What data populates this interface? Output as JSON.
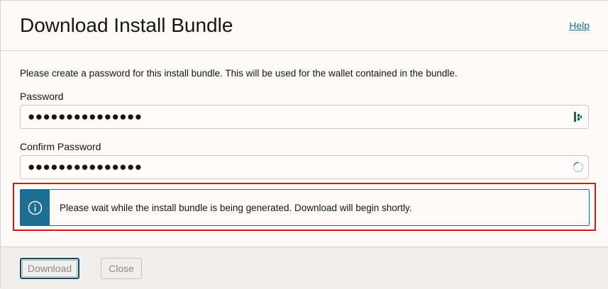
{
  "header": {
    "title": "Download Install Bundle",
    "help_label": "Help"
  },
  "form": {
    "instructions": "Please create a password for this install bundle. This will be used for the wallet contained in the bundle.",
    "password": {
      "label": "Password",
      "value": "●●●●●●●●●●●●●●●",
      "icon": "password-manager-icon"
    },
    "confirm_password": {
      "label": "Confirm Password",
      "value": "●●●●●●●●●●●●●●●",
      "icon": "loading-spinner-icon"
    }
  },
  "message": {
    "icon": "info-icon",
    "text": "Please wait while the install bundle is being generated. Download will begin shortly."
  },
  "footer": {
    "download_label": "Download",
    "close_label": "Close"
  },
  "colors": {
    "accent": "#1c6e92",
    "highlight": "#e01414",
    "link": "#1e6b92"
  }
}
